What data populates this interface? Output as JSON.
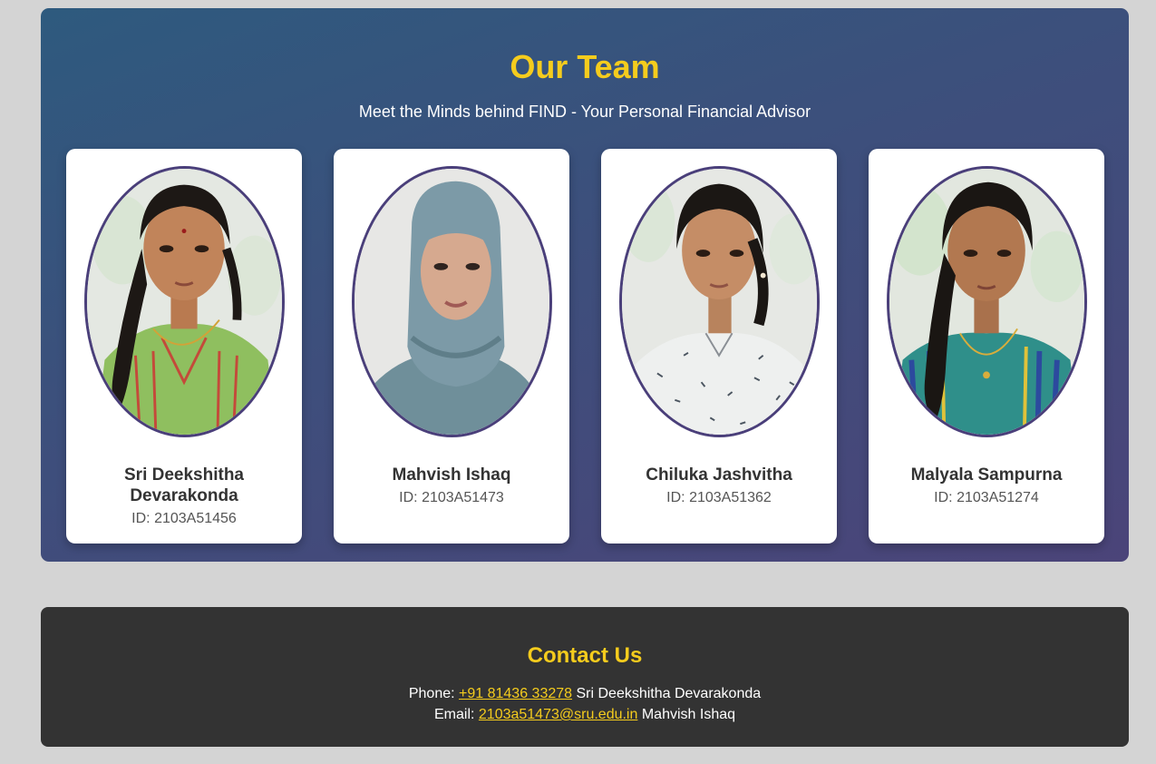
{
  "team": {
    "title": "Our Team",
    "subtitle": "Meet the Minds behind FIND - Your Personal Financial Advisor",
    "members": [
      {
        "name": "Sri Deekshitha Devarakonda",
        "id": "ID: 2103A51456",
        "photo_alt": "Photo of Sri Deekshitha Devarakonda"
      },
      {
        "name": "Mahvish Ishaq",
        "id": "ID: 2103A51473",
        "photo_alt": "Photo of Mahvish Ishaq"
      },
      {
        "name": "Chiluka Jashvitha",
        "id": "ID: 2103A51362",
        "photo_alt": "Photo of Chiluka Jashvitha"
      },
      {
        "name": "Malyala Sampurna",
        "id": "ID: 2103A51274",
        "photo_alt": "Photo of Malyala Sampurna"
      }
    ]
  },
  "contact": {
    "title": "Contact Us",
    "phone_label": "Phone:",
    "phone_value": "+91 81436 33278",
    "phone_person": "Sri Deekshitha Devarakonda",
    "email_label": "Email:",
    "email_value": "2103a51473@sru.edu.in",
    "email_person": "Mahvish Ishaq"
  },
  "colors": {
    "accent": "#f5cc1d",
    "photo_border": "#4a3f7a",
    "contact_bg": "#333333"
  }
}
